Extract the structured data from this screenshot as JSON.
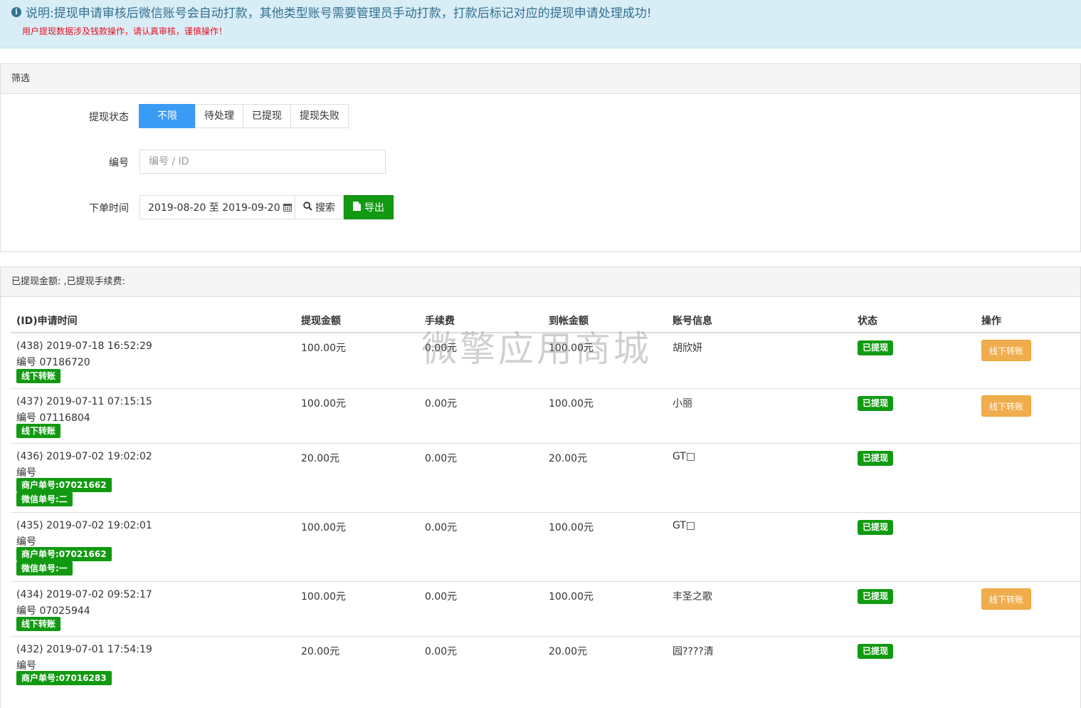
{
  "notice": {
    "info_icon": "info-circle-icon",
    "text": "说明:提现申请审核后微信账号会自动打款，其他类型账号需要管理员手动打款，打款后标记对应的提现申请处理成功!",
    "warning": "用户提现数据涉及钱款操作，请认真审核，谨慎操作！"
  },
  "filter": {
    "heading": "筛选",
    "status_label": "提现状态",
    "status_options": [
      "不限",
      "待处理",
      "已提现",
      "提现失败"
    ],
    "status_selected": "不限",
    "number_label": "编号",
    "number_placeholder": "编号 / ID",
    "number_value": "",
    "date_label": "下单时间",
    "date_range": "2019-08-20 至 2019-09-20",
    "search_label": "搜索",
    "export_label": "导出"
  },
  "summary": {
    "heading": "已提现金额: ,已提现手续费:"
  },
  "table": {
    "columns": [
      "(ID)申请时间",
      "提现金额",
      "手续费",
      "到帐金额",
      "账号信息",
      "状态",
      "操作"
    ],
    "rows": [
      {
        "id_time": "(438) 2019-07-18 16:52:29",
        "number": "编号 07186720",
        "tags": [
          "线下转账"
        ],
        "amount": "100.00元",
        "fee": "0.00元",
        "received": "100.00元",
        "account": "胡欣妍",
        "status": "已提现",
        "action": "线下转账"
      },
      {
        "id_time": "(437) 2019-07-11 07:15:15",
        "number": "编号 07116804",
        "tags": [
          "线下转账"
        ],
        "amount": "100.00元",
        "fee": "0.00元",
        "received": "100.00元",
        "account": "小丽",
        "status": "已提现",
        "action": "线下转账"
      },
      {
        "id_time": "(436) 2019-07-02 19:02:02",
        "number": "编号",
        "tags": [
          "商户单号:07021662",
          "微信单号:二"
        ],
        "amount": "20.00元",
        "fee": "0.00元",
        "received": "20.00元",
        "account": "GT□",
        "status": "已提现",
        "action": ""
      },
      {
        "id_time": "(435) 2019-07-02 19:02:01",
        "number": "编号",
        "tags": [
          "商户单号:07021662",
          "微信单号:一"
        ],
        "amount": "100.00元",
        "fee": "0.00元",
        "received": "100.00元",
        "account": "GT□",
        "status": "已提现",
        "action": ""
      },
      {
        "id_time": "(434) 2019-07-02 09:52:17",
        "number": "编号 07025944",
        "tags": [
          "线下转账"
        ],
        "amount": "100.00元",
        "fee": "0.00元",
        "received": "100.00元",
        "account": "丰圣之歌",
        "status": "已提现",
        "action": "线下转账"
      },
      {
        "id_time": "(432) 2019-07-01 17:54:19",
        "number": "编号",
        "tags": [
          "商户单号:07016283"
        ],
        "amount": "20.00元",
        "fee": "0.00元",
        "received": "20.00元",
        "account": "园????清",
        "status": "已提现",
        "action": ""
      }
    ]
  },
  "watermark": "微擎应用商城"
}
